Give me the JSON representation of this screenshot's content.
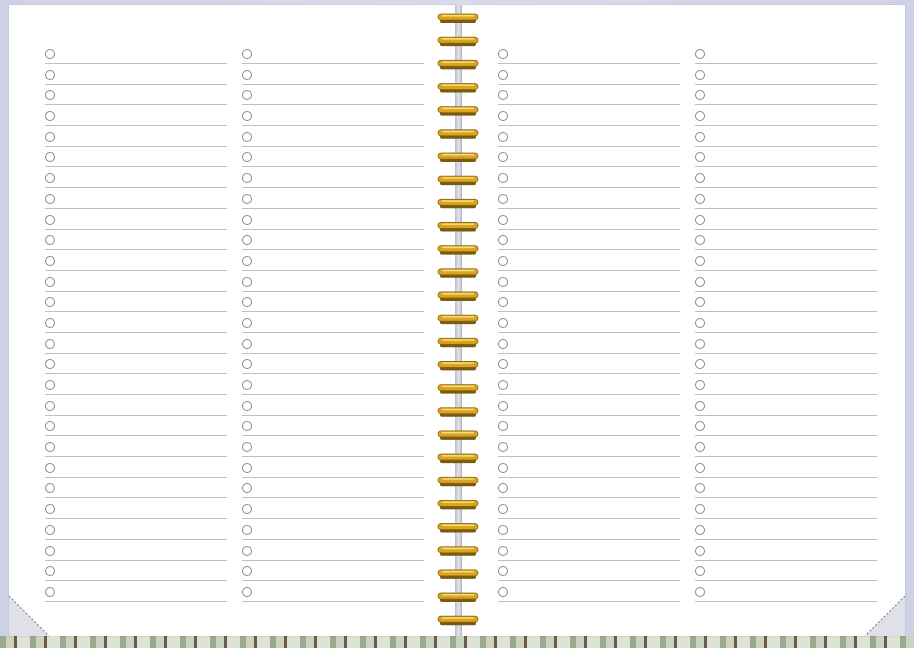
{
  "notebook": {
    "cover_color": "#d3d6e8",
    "ring_color": "#d9a521",
    "rows_per_column": 27,
    "columns_per_page": 2,
    "ring_count": 27,
    "bullet_icon": "circle-outline-icon"
  }
}
